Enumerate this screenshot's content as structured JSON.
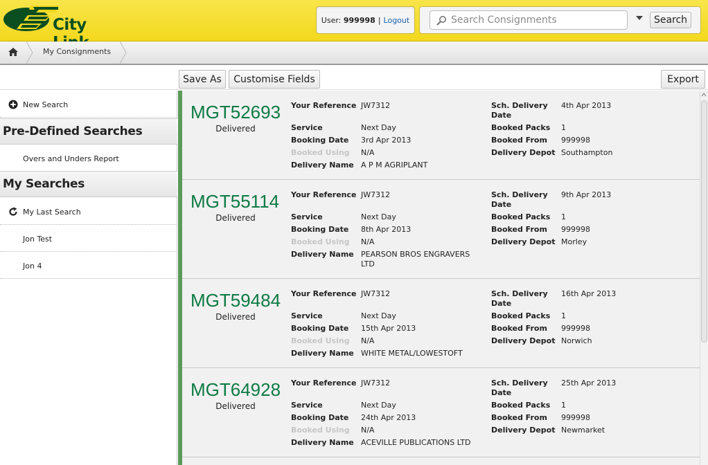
{
  "brand": {
    "name": "City Link"
  },
  "user": {
    "label": "User:",
    "id": "999998",
    "logout": "Logout"
  },
  "search": {
    "placeholder": "Search Consignments",
    "button": "Search"
  },
  "breadcrumb": {
    "current": "My Consignments"
  },
  "toolbar": {
    "save_as": "Save As",
    "customise": "Customise Fields",
    "export": "Export"
  },
  "sidebar": {
    "new_search": "New Search",
    "predefined_title": "Pre-Defined Searches",
    "predefined_items": [
      "Overs and Unders Report"
    ],
    "my_searches_title": "My Searches",
    "last_search": "My Last Search",
    "my_items": [
      "Jon Test",
      "Jon 4"
    ]
  },
  "labels": {
    "your_reference": "Your Reference",
    "service": "Service",
    "booking_date": "Booking Date",
    "booked_using": "Booked Using",
    "delivery_name": "Delivery Name",
    "sch_delivery": "Sch. Delivery",
    "date": "Date",
    "booked_packs": "Booked Packs",
    "booked_from": "Booked From",
    "delivery_depot": "Delivery Depot"
  },
  "consignments": [
    {
      "number": "MGT52693",
      "status": "Delivered",
      "reference": "JW7312",
      "service": "Next Day",
      "booking_date": "3rd Apr 2013",
      "booked_using": "N/A",
      "delivery_name": "A P M AGRIPLANT",
      "delivery_name_2": "",
      "sch_delivery_date": "4th Apr 2013",
      "booked_packs": "1",
      "booked_from": "999998",
      "delivery_depot": "Southampton"
    },
    {
      "number": "MGT55114",
      "status": "Delivered",
      "reference": "JW7312",
      "service": "Next Day",
      "booking_date": "8th Apr 2013",
      "booked_using": "N/A",
      "delivery_name": "PEARSON BROS ENGRAVERS",
      "delivery_name_2": "LTD",
      "sch_delivery_date": "9th Apr 2013",
      "booked_packs": "1",
      "booked_from": "999998",
      "delivery_depot": "Morley"
    },
    {
      "number": "MGT59484",
      "status": "Delivered",
      "reference": "JW7312",
      "service": "Next Day",
      "booking_date": "15th Apr 2013",
      "booked_using": "N/A",
      "delivery_name": "WHITE METAL/LOWESTOFT",
      "delivery_name_2": "",
      "sch_delivery_date": "16th Apr 2013",
      "booked_packs": "1",
      "booked_from": "999998",
      "delivery_depot": "Norwich"
    },
    {
      "number": "MGT64928",
      "status": "Delivered",
      "reference": "JW7312",
      "service": "Next Day",
      "booking_date": "24th Apr 2013",
      "booked_using": "N/A",
      "delivery_name": "ACEVILLE PUBLICATIONS LTD",
      "delivery_name_2": "",
      "sch_delivery_date": "25th Apr 2013",
      "booked_packs": "1",
      "booked_from": "999998",
      "delivery_depot": "Newmarket"
    }
  ],
  "colors": {
    "header": "#f3d81e",
    "brand_green": "#0d7a43",
    "link": "#1a5fa8",
    "accent_bar": "#5a9a5a"
  }
}
